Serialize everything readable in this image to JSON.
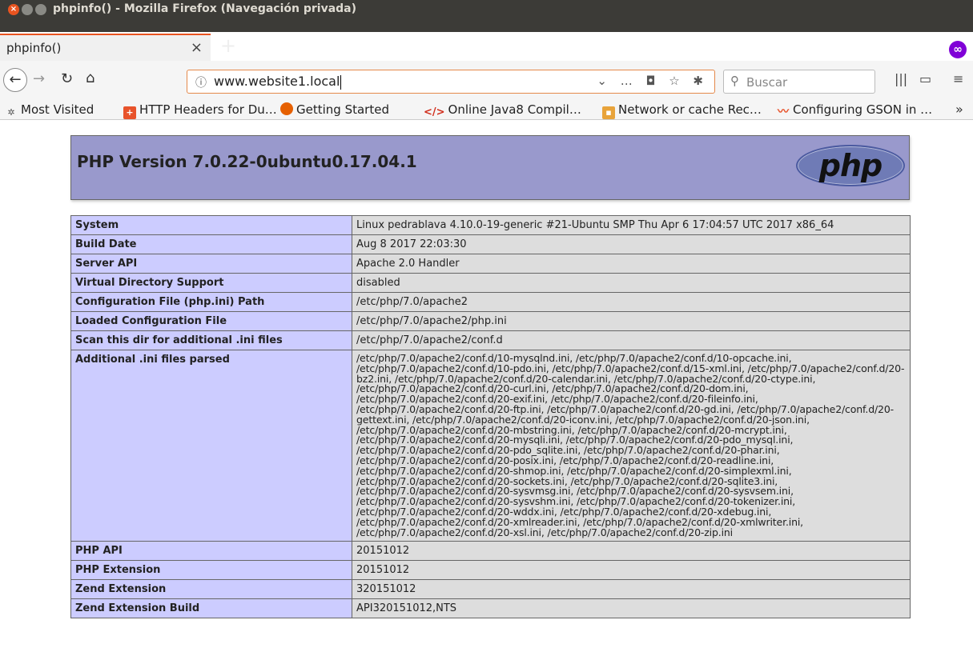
{
  "window": {
    "title": "phpinfo() - Mozilla Firefox (Navegación privada)"
  },
  "tab": {
    "title": "phpinfo()"
  },
  "toolbar": {
    "url": "www.website1.local",
    "search_placeholder": "Buscar"
  },
  "bookmarks": [
    {
      "label": "Most Visited",
      "icon": "gear-icon"
    },
    {
      "label": "HTTP Headers for Du…",
      "icon": "plus-icon"
    },
    {
      "label": "Getting Started",
      "icon": "firefox-icon"
    },
    {
      "label": "Online Java8 Compil…",
      "icon": "code-icon"
    },
    {
      "label": "Network or cache Rec…",
      "icon": "document-icon"
    },
    {
      "label": "Configuring GSON in …",
      "icon": "wave-icon"
    }
  ],
  "php": {
    "version_title": "PHP Version 7.0.22-0ubuntu0.17.04.1",
    "logo_text": "php",
    "rows": [
      {
        "key": "System",
        "value": "Linux pedrablava 4.10.0-19-generic #21-Ubuntu SMP Thu Apr 6 17:04:57 UTC 2017 x86_64"
      },
      {
        "key": "Build Date",
        "value": "Aug 8 2017 22:03:30"
      },
      {
        "key": "Server API",
        "value": "Apache 2.0 Handler"
      },
      {
        "key": "Virtual Directory Support",
        "value": "disabled"
      },
      {
        "key": "Configuration File (php.ini) Path",
        "value": "/etc/php/7.0/apache2"
      },
      {
        "key": "Loaded Configuration File",
        "value": "/etc/php/7.0/apache2/php.ini"
      },
      {
        "key": "Scan this dir for additional .ini files",
        "value": "/etc/php/7.0/apache2/conf.d"
      },
      {
        "key": "Additional .ini files parsed",
        "value": "/etc/php/7.0/apache2/conf.d/10-mysqlnd.ini, /etc/php/7.0/apache2/conf.d/10-opcache.ini, /etc/php/7.0/apache2/conf.d/10-pdo.ini, /etc/php/7.0/apache2/conf.d/15-xml.ini, /etc/php/7.0/apache2/conf.d/20-bz2.ini, /etc/php/7.0/apache2/conf.d/20-calendar.ini, /etc/php/7.0/apache2/conf.d/20-ctype.ini, /etc/php/7.0/apache2/conf.d/20-curl.ini, /etc/php/7.0/apache2/conf.d/20-dom.ini, /etc/php/7.0/apache2/conf.d/20-exif.ini, /etc/php/7.0/apache2/conf.d/20-fileinfo.ini, /etc/php/7.0/apache2/conf.d/20-ftp.ini, /etc/php/7.0/apache2/conf.d/20-gd.ini, /etc/php/7.0/apache2/conf.d/20-gettext.ini, /etc/php/7.0/apache2/conf.d/20-iconv.ini, /etc/php/7.0/apache2/conf.d/20-json.ini, /etc/php/7.0/apache2/conf.d/20-mbstring.ini, /etc/php/7.0/apache2/conf.d/20-mcrypt.ini, /etc/php/7.0/apache2/conf.d/20-mysqli.ini, /etc/php/7.0/apache2/conf.d/20-pdo_mysql.ini, /etc/php/7.0/apache2/conf.d/20-pdo_sqlite.ini, /etc/php/7.0/apache2/conf.d/20-phar.ini, /etc/php/7.0/apache2/conf.d/20-posix.ini, /etc/php/7.0/apache2/conf.d/20-readline.ini, /etc/php/7.0/apache2/conf.d/20-shmop.ini, /etc/php/7.0/apache2/conf.d/20-simplexml.ini, /etc/php/7.0/apache2/conf.d/20-sockets.ini, /etc/php/7.0/apache2/conf.d/20-sqlite3.ini, /etc/php/7.0/apache2/conf.d/20-sysvmsg.ini, /etc/php/7.0/apache2/conf.d/20-sysvsem.ini, /etc/php/7.0/apache2/conf.d/20-sysvshm.ini, /etc/php/7.0/apache2/conf.d/20-tokenizer.ini, /etc/php/7.0/apache2/conf.d/20-wddx.ini, /etc/php/7.0/apache2/conf.d/20-xdebug.ini, /etc/php/7.0/apache2/conf.d/20-xmlreader.ini, /etc/php/7.0/apache2/conf.d/20-xmlwriter.ini, /etc/php/7.0/apache2/conf.d/20-xsl.ini, /etc/php/7.0/apache2/conf.d/20-zip.ini"
      },
      {
        "key": "PHP API",
        "value": "20151012"
      },
      {
        "key": "PHP Extension",
        "value": "20151012"
      },
      {
        "key": "Zend Extension",
        "value": "320151012"
      },
      {
        "key": "Zend Extension Build",
        "value": "API320151012,NTS"
      }
    ]
  }
}
